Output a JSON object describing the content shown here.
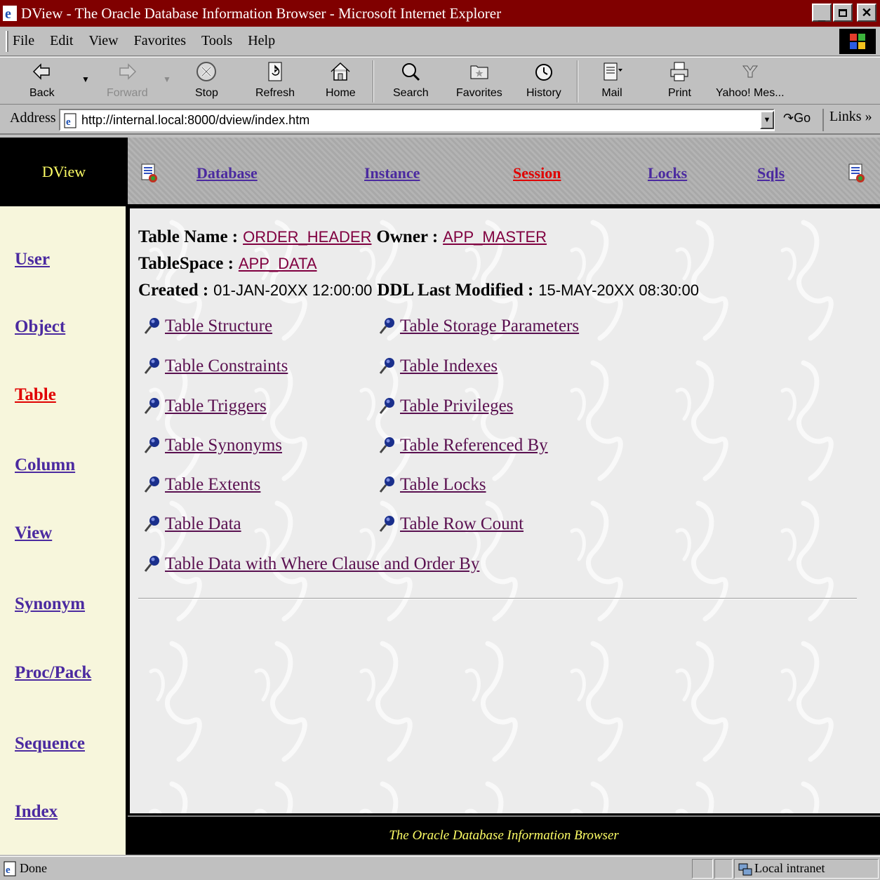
{
  "window": {
    "title": "DView - The Oracle Database Information Browser - Microsoft Internet Explorer"
  },
  "menu": [
    "File",
    "Edit",
    "View",
    "Favorites",
    "Tools",
    "Help"
  ],
  "toolbar": {
    "back": "Back",
    "forward": "Forward",
    "stop": "Stop",
    "refresh": "Refresh",
    "home": "Home",
    "search": "Search",
    "favorites": "Favorites",
    "history": "History",
    "mail": "Mail",
    "print": "Print",
    "messenger": "Yahoo! Mes..."
  },
  "address": {
    "label": "Address",
    "url": "http://internal.local:8000/dview/index.htm",
    "go": "Go",
    "links": "Links"
  },
  "brand": "DView",
  "topnav": [
    "Database",
    "Instance",
    "Session",
    "Locks",
    "Sqls"
  ],
  "topnav_active": "Session",
  "sidebar": [
    "User",
    "Object",
    "Table",
    "Column",
    "View",
    "Synonym",
    "Proc/Pack",
    "Sequence",
    "Index"
  ],
  "sidebar_active": "Table",
  "table_info": {
    "name_label": "Table Name :",
    "name": "ORDER_HEADER",
    "owner_label": "Owner :",
    "owner": "APP_MASTER",
    "tablespace_label": "TableSpace :",
    "tablespace": "APP_DATA",
    "created_label": "Created :",
    "created": "01-JAN-20XX 12:00:00",
    "ddl_label": "DDL Last Modified :",
    "ddl": "15-MAY-20XX 08:30:00"
  },
  "links_left": [
    "Table Structure",
    "Table Constraints",
    "Table Triggers",
    "Table Synonyms",
    "Table Extents",
    "Table Data",
    "Table Data with Where Clause and Order By"
  ],
  "links_right": [
    "Table Storage Parameters",
    "Table Indexes",
    "Table Privileges",
    "Table Referenced By",
    "Table Locks",
    "Table Row Count"
  ],
  "footer": "The Oracle Database Information Browser",
  "status": {
    "text": "Done",
    "zone": "Local intranet"
  },
  "colors": {
    "titlebar": "#800000",
    "nav_link": "#4b2aa0",
    "active_link": "#e00000",
    "content_link": "#5a1050",
    "brand_text": "#ffff66"
  }
}
